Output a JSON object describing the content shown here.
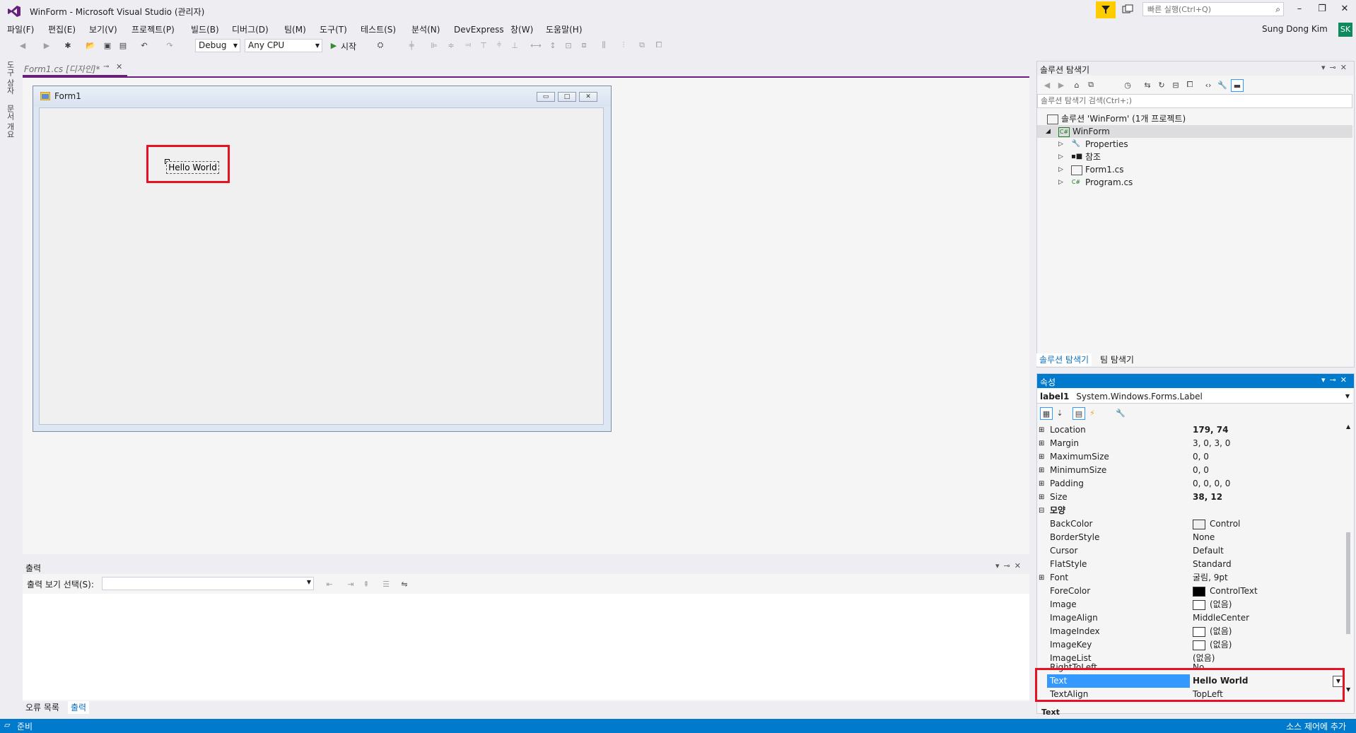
{
  "window": {
    "title": "WinForm - Microsoft Visual Studio  (관리자)",
    "quick_launch_placeholder": "빠른 실행(Ctrl+Q)",
    "user_name": "Sung Dong Kim",
    "user_initials": "SK"
  },
  "menu": [
    "파일(F)",
    "편집(E)",
    "보기(V)",
    "프로젝트(P)",
    "빌드(B)",
    "디버그(D)",
    "팀(M)",
    "도구(T)",
    "테스트(S)",
    "분석(N)",
    "DevExpress",
    "창(W)",
    "도움말(H)"
  ],
  "toolbar": {
    "config": "Debug",
    "platform": "Any CPU",
    "start_label": "시작"
  },
  "left_strip": {
    "toolbox": "도구 상자",
    "doc_outline": "문서 개요"
  },
  "document_tab": {
    "label": "Form1.cs [디자인]*"
  },
  "designer": {
    "form_title": "Form1",
    "label_text": "Hello World"
  },
  "output": {
    "title": "출력",
    "source_label": "출력 보기 선택(S):",
    "source_value": "",
    "bottom_tabs": [
      "오류 목록",
      "출력"
    ]
  },
  "solution_explorer": {
    "title": "솔루션 탐색기",
    "search_placeholder": "솔루션 탐색기 검색(Ctrl+;)",
    "solution_label": "솔루션 'WinForm' (1개 프로젝트)",
    "project_label": "WinForm",
    "items": [
      "Properties",
      "참조",
      "Form1.cs",
      "Program.cs"
    ],
    "tabs": [
      "솔루션 탐색기",
      "팀 탐색기"
    ]
  },
  "properties": {
    "title": "속성",
    "object_name": "label1",
    "object_type": "System.Windows.Forms.Label",
    "rows": [
      {
        "name": "Location",
        "value": "179, 74",
        "expand": "⊞",
        "bold": true
      },
      {
        "name": "Margin",
        "value": "3, 0, 3, 0",
        "expand": "⊞"
      },
      {
        "name": "MaximumSize",
        "value": "0, 0",
        "expand": "⊞"
      },
      {
        "name": "MinimumSize",
        "value": "0, 0",
        "expand": "⊞"
      },
      {
        "name": "Padding",
        "value": "0, 0, 0, 0",
        "expand": "⊞"
      },
      {
        "name": "Size",
        "value": "38, 12",
        "expand": "⊞",
        "bold": true
      },
      {
        "name": "모양",
        "value": "",
        "expand": "⊟",
        "category": true
      },
      {
        "name": "BackColor",
        "value": "Control",
        "swatch": "#F0F0F0"
      },
      {
        "name": "BorderStyle",
        "value": "None"
      },
      {
        "name": "Cursor",
        "value": "Default"
      },
      {
        "name": "FlatStyle",
        "value": "Standard"
      },
      {
        "name": "Font",
        "value": "굴림, 9pt",
        "expand": "⊞"
      },
      {
        "name": "ForeColor",
        "value": "ControlText",
        "swatch": "#000000"
      },
      {
        "name": "Image",
        "value": "(없음)",
        "swatch": "#FFFFFF"
      },
      {
        "name": "ImageAlign",
        "value": "MiddleCenter"
      },
      {
        "name": "ImageIndex",
        "value": "(없음)",
        "swatch": "#FFFFFF"
      },
      {
        "name": "ImageKey",
        "value": "(없음)",
        "swatch": "#FFFFFF"
      },
      {
        "name": "ImageList",
        "value": "(없음)"
      },
      {
        "name": "RightToLeft",
        "value": "No"
      },
      {
        "name": "Text",
        "value": "Hello World",
        "selected": true,
        "bold": true
      },
      {
        "name": "TextAlign",
        "value": "TopLeft"
      }
    ],
    "description_title": "Text"
  },
  "status": {
    "text": "준비",
    "right": "소스 제어에 추가"
  },
  "colors": {
    "accent": "#007ACC",
    "highlight_box": "#E81123",
    "selection": "#3399FF"
  }
}
